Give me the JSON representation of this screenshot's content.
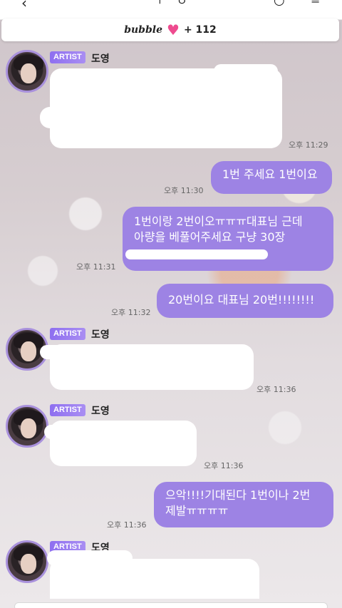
{
  "header": {
    "brand": "bubble",
    "count": "+ 112"
  },
  "colors": {
    "bubble_out": "#9d83e4",
    "badge": "#8e6ff0",
    "heart": "#ee4b8f"
  },
  "messages": [
    {
      "type": "in",
      "badge": "ARTIST",
      "sender": "도영",
      "time": "오후 11:29"
    },
    {
      "type": "out",
      "lines": [
        "1번 주세요 1번이요"
      ],
      "time": "오후 11:30"
    },
    {
      "type": "out",
      "lines": [
        "1번이랑 2번이오ㅠㅠㅠ대표님 근데",
        "아량을 베풀어주세요 구냥 30장"
      ],
      "time": "오후 11:31"
    },
    {
      "type": "out",
      "lines": [
        "20번이요 대표님 20번!!!!!!!!"
      ],
      "time": "오후 11:32"
    },
    {
      "type": "in",
      "badge": "ARTIST",
      "sender": "도영",
      "time": "오후 11:36"
    },
    {
      "type": "in",
      "badge": "ARTIST",
      "sender": "도영",
      "time": "오후 11:36"
    },
    {
      "type": "out",
      "lines": [
        "으악!!!!기대된다 1번이나 2번",
        "제발ㅠㅠㅠㅠ"
      ],
      "time": "오후 11:36"
    },
    {
      "type": "in",
      "badge": "ARTIST",
      "sender": "도영"
    }
  ]
}
